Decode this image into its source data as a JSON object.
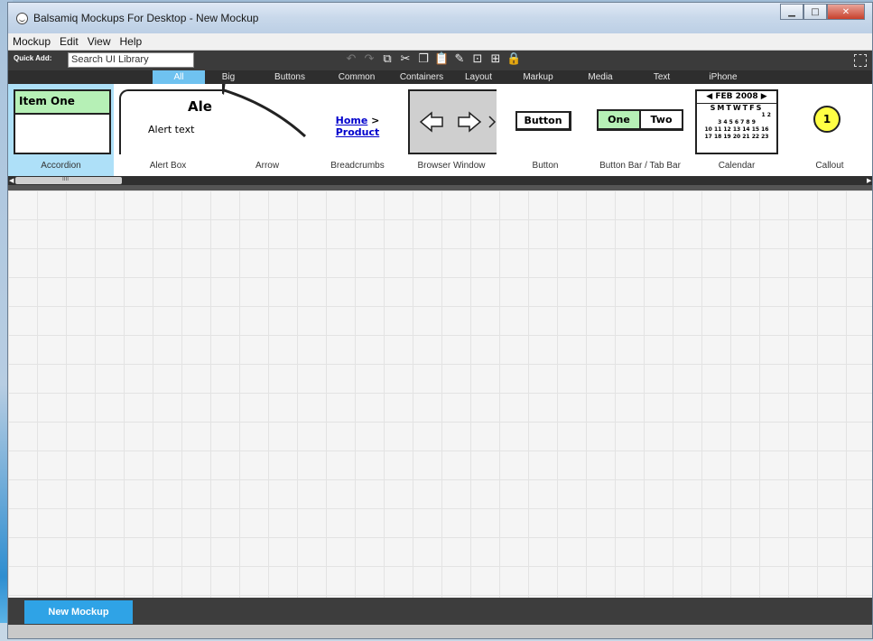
{
  "window": {
    "title": "Balsamiq Mockups For Desktop - New Mockup"
  },
  "menu": [
    "Mockup",
    "Edit",
    "View",
    "Help"
  ],
  "quick_add": {
    "label": "Quick Add:",
    "placeholder": "Search UI Library"
  },
  "categories": [
    "All",
    "Big",
    "Buttons",
    "Common",
    "Containers",
    "Layout",
    "Markup",
    "Media",
    "Text",
    "iPhone"
  ],
  "active_category": "All",
  "library": [
    {
      "label": "Accordion",
      "selected": true,
      "item_text": "Item One"
    },
    {
      "label": "Alert Box",
      "heading": "Ale",
      "text": "Alert text"
    },
    {
      "label": "Arrow"
    },
    {
      "label": "Breadcrumbs",
      "crumbs": [
        "Home",
        "Product"
      ],
      "separator": ">"
    },
    {
      "label": "Browser Window"
    },
    {
      "label": "Button",
      "button_text": "Button"
    },
    {
      "label": "Button Bar / Tab Bar",
      "tabs": [
        "One",
        "Two"
      ]
    },
    {
      "label": "Calendar",
      "month": "FEB 2008",
      "days": "SMTWTFS",
      "rows": [
        "1 2",
        "3 4 5 6 7 8 9",
        "10 11 12 13 14 15 16",
        "17 18 19 20 21 22 23"
      ]
    },
    {
      "label": "Callout",
      "number": "1"
    }
  ],
  "scrollbar_grip": "IIII",
  "bottom": {
    "new_mockup": "New Mockup"
  },
  "colors": {
    "accent": "#2fa3e6",
    "selected_item": "#aee0f8",
    "accordion_green": "#b6f0b6"
  }
}
